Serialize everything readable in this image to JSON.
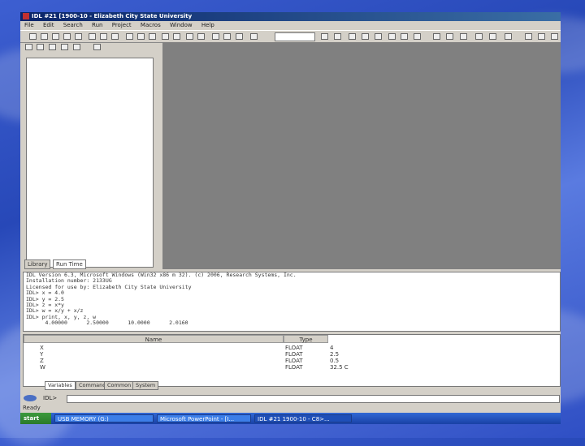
{
  "window": {
    "title": "IDL #21 [1900-10 - Elizabeth City State University"
  },
  "menu": [
    "File",
    "Edit",
    "Search",
    "Run",
    "Project",
    "Macros",
    "Window",
    "Help"
  ],
  "panel_tabs": [
    "Library",
    "Run Time"
  ],
  "console_lines": [
    "IDL Version 6.3, Microsoft Windows (Win32 x86 m 32). (c) 2006, Research Systems, Inc.",
    "Installation number: 2133UG",
    "Licensed for use by: Elizabeth City State University",
    "",
    "IDL> x = 4.0",
    "IDL> y = 2.5",
    "IDL> z = x*y",
    "IDL> w = x/y + x/z",
    "IDL> print, x, y, z, w",
    "      4.00000      2.50000      10.0000      2.0160"
  ],
  "variables": {
    "headers": [
      "Name",
      "Type"
    ],
    "rows": [
      {
        "name": "X",
        "type": "FLOAT",
        "value": "4"
      },
      {
        "name": "Y",
        "type": "FLOAT",
        "value": "2.5"
      },
      {
        "name": "Z",
        "type": "FLOAT",
        "value": "0.5"
      },
      {
        "name": "W",
        "type": "FLOAT",
        "value": "32.5 C"
      }
    ]
  },
  "bottom_tabs": [
    "Variables",
    "Command",
    "Common",
    "System"
  ],
  "command": {
    "label": "IDL>"
  },
  "status": "Ready",
  "taskbar": {
    "start": "start",
    "tasks": [
      "USB MEMORY (G:)",
      "Microsoft PowerPoint - [I...",
      "IDL #21 1900-10 - C8>..."
    ]
  }
}
